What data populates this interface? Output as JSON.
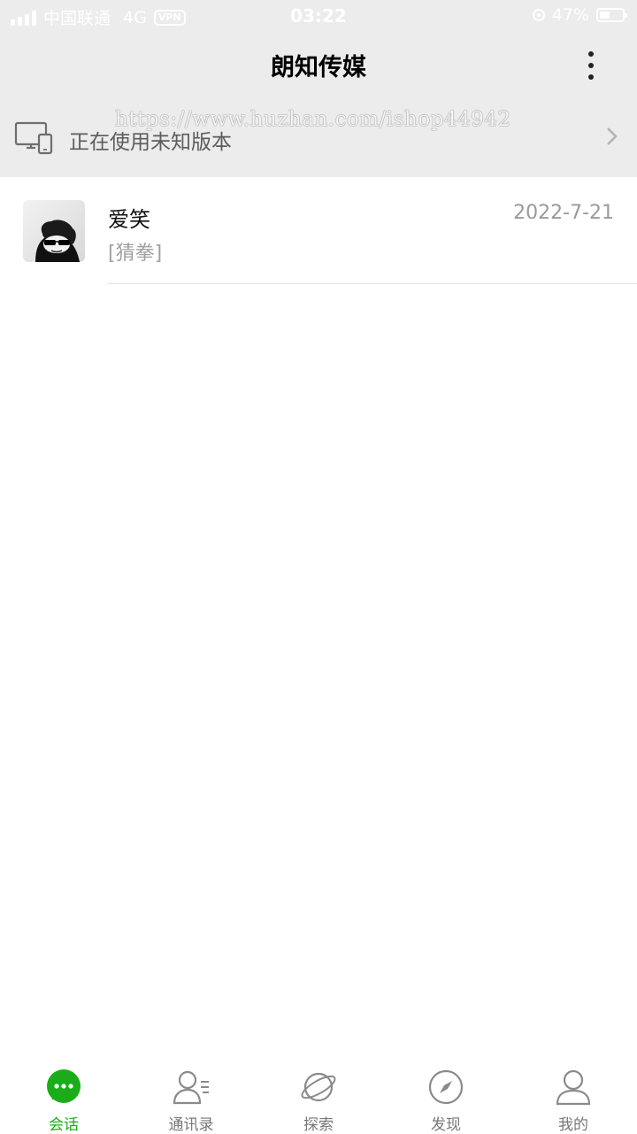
{
  "status_bar": {
    "carrier": "中国联通",
    "network": "4G",
    "vpn": "VPN",
    "time": "03:22",
    "battery": "47%",
    "battery_level": 0.47
  },
  "header": {
    "title": "朗知传媒",
    "more_icon": "more-vertical-icon"
  },
  "notice": {
    "text": "正在使用未知版本",
    "icon": "desktop-phone-icon",
    "arrow_icon": "chevron-right-icon"
  },
  "watermark": "https://www.huzhan.com/ishop44942",
  "conversations": [
    {
      "name": "爱笑",
      "time": "2022-7-21",
      "preview": "[猜拳]"
    }
  ],
  "tabs": [
    {
      "label": "会话",
      "icon": "chat-bubble-icon",
      "active": true
    },
    {
      "label": "通讯录",
      "icon": "contacts-icon",
      "active": false
    },
    {
      "label": "探索",
      "icon": "planet-icon",
      "active": false
    },
    {
      "label": "发现",
      "icon": "compass-icon",
      "active": false
    },
    {
      "label": "我的",
      "icon": "person-icon",
      "active": false
    }
  ],
  "colors": {
    "accent": "#1aad19",
    "header_bg": "#ececec",
    "text_secondary": "#9a9a9a"
  }
}
